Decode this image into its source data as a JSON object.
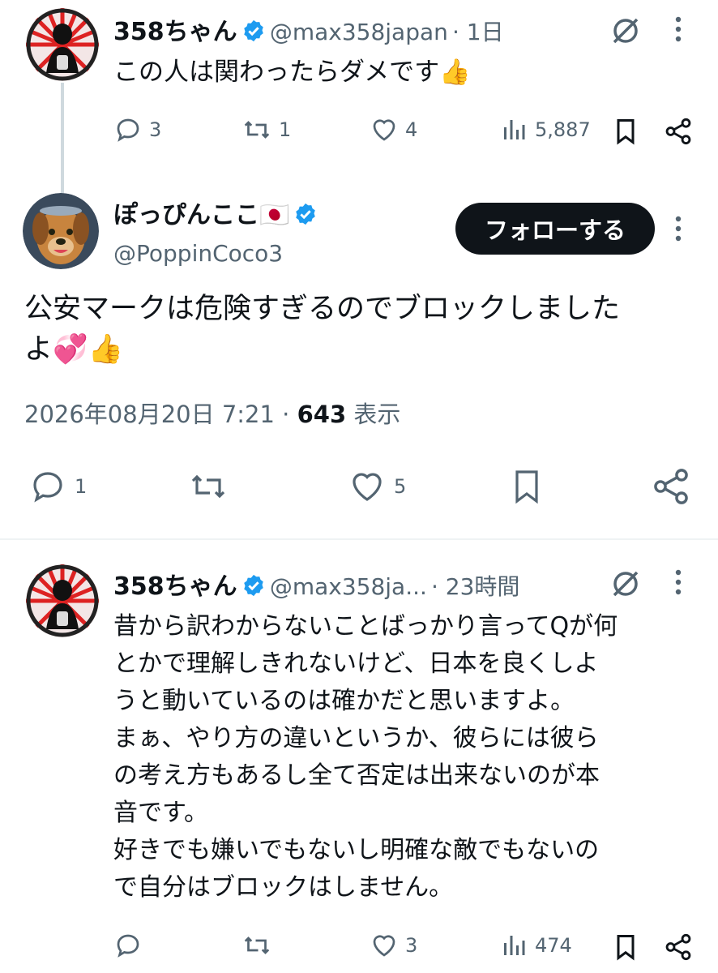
{
  "tweet1": {
    "name": "358ちゃん",
    "handle": "@max358japan",
    "time": "· 1日",
    "text": "この人は関わったらダメです👍",
    "replies": "3",
    "retweets": "1",
    "likes": "4",
    "views": "5,887"
  },
  "main": {
    "name": "ぽっぴんここ🇯🇵",
    "handle": "@PoppinCoco3",
    "follow_label": "フォローする",
    "text_line1": "公安マークは危険すぎるのでブロックしました",
    "text_line2": "よ💞👍",
    "date": "2026年08月20日 7:21 · ",
    "views_count": "643",
    "views_label": " 表示",
    "replies": "1",
    "likes": "5"
  },
  "reply": {
    "name": "358ちゃん",
    "handle": "@max358ja...",
    "time": "· 23時間",
    "lines": [
      "昔から訳わからないことばっかり言ってQが何",
      "とかで理解しきれないけど、日本を良くしよ",
      "うと動いているのは確かだと思いますよ。",
      "まぁ、やり方の違いというか、彼らには彼ら",
      "の考え方もあるし全て否定は出来ないのが本",
      "音です。",
      "好きでも嫌いでもないし明確な敵でもないの",
      "で自分はブロックはしません。"
    ],
    "likes": "3",
    "views": "474"
  },
  "colors": {
    "text": "#0f1419",
    "secondary": "#536471",
    "verified": "#1d9bf0",
    "follow_bg": "#0f1419"
  }
}
